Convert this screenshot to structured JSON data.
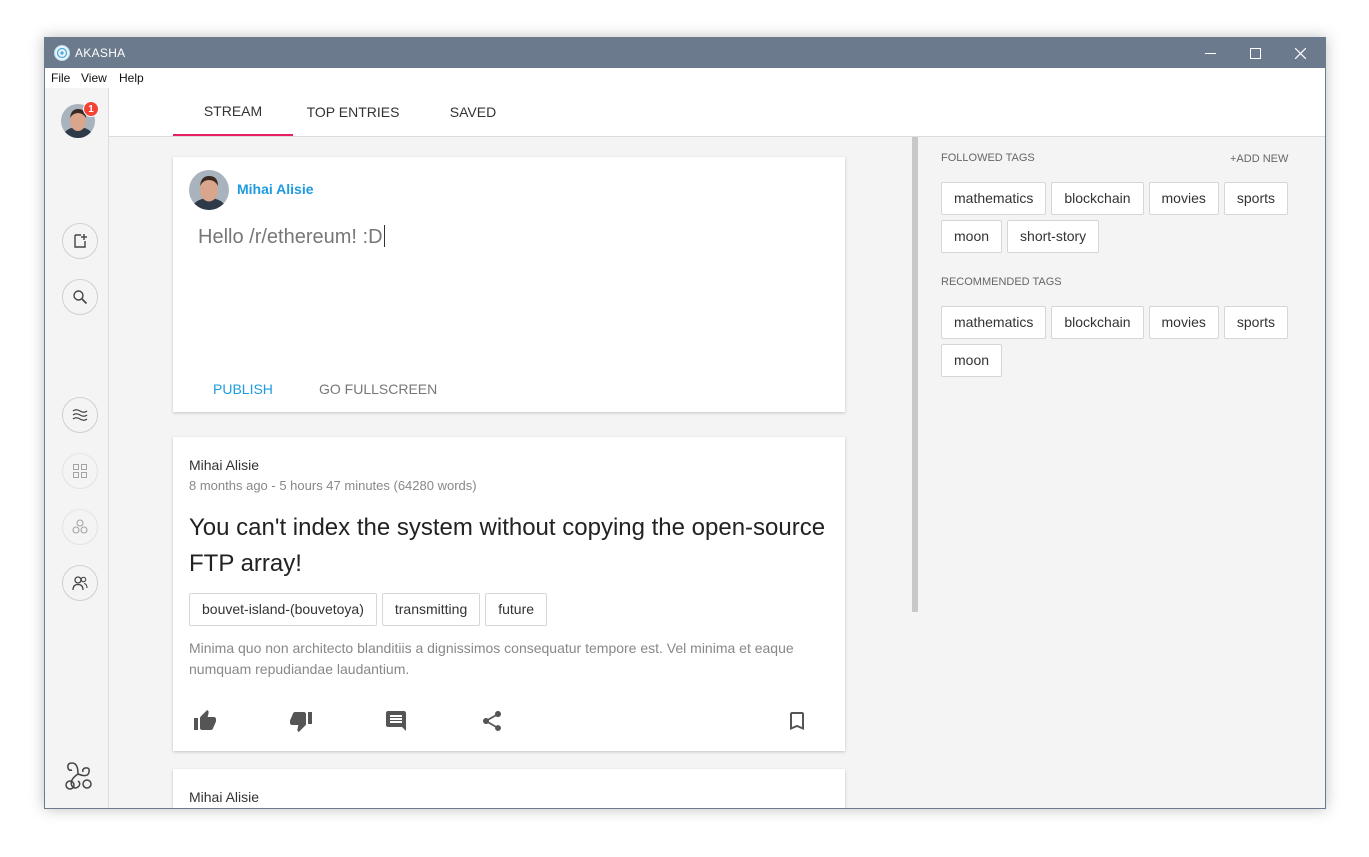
{
  "window": {
    "title": "AKASHA",
    "minimize_icon": "minimize-icon",
    "maximize_icon": "maximize-icon",
    "close_icon": "close-icon"
  },
  "menu": [
    "File",
    "View",
    "Help"
  ],
  "sidebar": {
    "notification_count": "1",
    "buttons": [
      "new-entry-icon",
      "search-icon",
      "stream-icon",
      "apps-icon",
      "communities-icon",
      "people-icon"
    ],
    "logo": "akasha-logo-icon"
  },
  "tabs": [
    {
      "label": "STREAM",
      "active": true
    },
    {
      "label": "TOP ENTRIES",
      "active": false
    },
    {
      "label": "SAVED",
      "active": false
    }
  ],
  "editor": {
    "author": "Mihai Alisie",
    "text": "Hello /r/ethereum! :D",
    "publish_label": "PUBLISH",
    "fullscreen_label": "GO FULLSCREEN"
  },
  "entries": [
    {
      "author": "Mihai Alisie",
      "meta": "8 months ago - 5 hours 47 minutes (64280 words)",
      "title": "You can't index the system without copying the open-source FTP array!",
      "tags": [
        "bouvet-island-(bouvetoya)",
        "transmitting",
        "future"
      ],
      "excerpt": "Minima quo non architecto blanditiis a dignissimos consequatur tempore est. Vel minima et eaque numquam repudiandae laudantium.",
      "actions": [
        "thumb-up-icon",
        "thumb-down-icon",
        "comment-icon",
        "share-icon",
        "bookmark-icon"
      ]
    },
    {
      "author": "Mihai Alisie"
    }
  ],
  "followed_tags": {
    "heading": "FOLLOWED TAGS",
    "add_label": "+ADD NEW",
    "tags": [
      "mathematics",
      "blockchain",
      "movies",
      "sports",
      "moon",
      "short-story"
    ]
  },
  "recommended_tags": {
    "heading": "RECOMMENDED TAGS",
    "tags": [
      "mathematics",
      "blockchain",
      "movies",
      "sports",
      "moon"
    ]
  },
  "colors": {
    "titlebar": "#6b7a8c",
    "accent": "#1e9be0",
    "tab_indicator": "#e91e63",
    "badge": "#f44336"
  }
}
